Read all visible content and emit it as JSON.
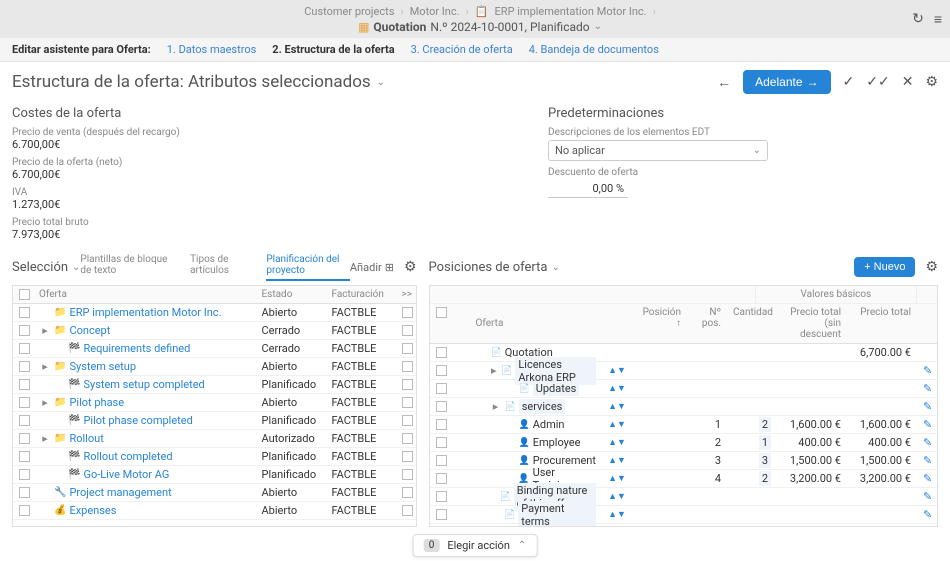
{
  "breadcrumb": {
    "items": [
      "Customer projects",
      "Motor Inc.",
      "ERP implementation Motor Inc."
    ],
    "doc_icon": "📄",
    "doc_title": "Quotation",
    "doc_number": "N.º 2024-10-0001, Planificado"
  },
  "wizard": {
    "label": "Editar asistente para Oferta:",
    "steps": [
      "1. Datos maestros",
      "2. Estructura de la oferta",
      "3. Creación de oferta",
      "4. Bandeja de documentos"
    ],
    "active_index": 1
  },
  "page": {
    "title": "Estructura de la oferta: Atributos seleccionados",
    "next_btn": "Adelante"
  },
  "costs": {
    "title": "Costes de la oferta",
    "items": [
      {
        "label": "Precio de venta (después del recargo)",
        "value": "6.700,00€"
      },
      {
        "label": "Precio de la oferta (neto)",
        "value": "6.700,00€"
      },
      {
        "label": "IVA",
        "value": "1.273,00€"
      },
      {
        "label": "Precio total bruto",
        "value": "7.973,00€"
      }
    ]
  },
  "defaults": {
    "title": "Predeterminaciones",
    "edt_label": "Descripciones de los elementos EDT",
    "edt_value": "No aplicar",
    "discount_label": "Descuento de oferta",
    "discount_value": "0,00 %"
  },
  "selection": {
    "title": "Selección",
    "tabs": [
      "Plantillas de bloque de texto",
      "Tipos de artículos",
      "Planificación del proyecto"
    ],
    "active_tab": 2,
    "add_label": "Añadir",
    "columns": {
      "name": "Oferta",
      "estado": "Estado",
      "fact": "Facturación",
      "star": ">>"
    },
    "rows": [
      {
        "indent": 0,
        "caret": "",
        "icon": "📁",
        "name": "ERP implementation Motor Inc.",
        "link": true,
        "estado": "Abierto",
        "fact": "FACTBLE"
      },
      {
        "indent": 0,
        "caret": "▸",
        "icon": "📁",
        "name": "Concept",
        "link": true,
        "estado": "Cerrado",
        "fact": "FACTBLE"
      },
      {
        "indent": 1,
        "caret": "",
        "icon": "🏁",
        "name": "Requirements defined",
        "link": true,
        "estado": "Cerrado",
        "fact": "FACTBLE"
      },
      {
        "indent": 0,
        "caret": "▸",
        "icon": "📁",
        "name": "System setup",
        "link": true,
        "estado": "Abierto",
        "fact": "FACTBLE"
      },
      {
        "indent": 1,
        "caret": "",
        "icon": "🏁",
        "name": "System setup completed",
        "link": true,
        "estado": "Planificado",
        "fact": "FACTBLE"
      },
      {
        "indent": 0,
        "caret": "▸",
        "icon": "📁",
        "name": "Pilot phase",
        "link": true,
        "estado": "Abierto",
        "fact": "FACTBLE"
      },
      {
        "indent": 1,
        "caret": "",
        "icon": "🏁",
        "name": "Pilot phase completed",
        "link": true,
        "estado": "Planificado",
        "fact": "FACTBLE"
      },
      {
        "indent": 0,
        "caret": "▸",
        "icon": "📁",
        "name": "Rollout",
        "link": true,
        "estado": "Autorizado",
        "fact": "FACTBLE"
      },
      {
        "indent": 1,
        "caret": "",
        "icon": "🏁",
        "name": "Rollout completed",
        "link": true,
        "estado": "Planificado",
        "fact": "FACTBLE"
      },
      {
        "indent": 1,
        "caret": "",
        "icon": "🏁",
        "name": "Go-Live Motor AG",
        "link": true,
        "estado": "Planificado",
        "fact": "FACTBLE"
      },
      {
        "indent": 0,
        "caret": "",
        "icon": "🔧",
        "name": "Project management",
        "link": true,
        "estado": "Abierto",
        "fact": "FACTBLE"
      },
      {
        "indent": 0,
        "caret": "",
        "icon": "💰",
        "name": "Expenses",
        "link": true,
        "estado": "Abierto",
        "fact": "FACTBLE"
      }
    ]
  },
  "positions": {
    "title": "Posiciones de oferta",
    "new_btn": "Nuevo",
    "group_header": "Valores básicos",
    "columns": {
      "offer": "Oferta",
      "pos": "Posición ↑",
      "npos": "Nº pos.",
      "qty": "Cantidad",
      "price": "Precio total (sin descuent",
      "total": "Precio total"
    },
    "rows": [
      {
        "indent": 0,
        "caret": "",
        "icon": "📄",
        "name": "Quotation",
        "pos": "",
        "npos": "",
        "qty": "",
        "price": "",
        "total": "6,700.00 €",
        "edit": false,
        "arrows": false
      },
      {
        "indent": 1,
        "caret": "▸",
        "icon": "📄",
        "name": "Licences Arkona ERP",
        "pos": "",
        "npos": "",
        "qty": "",
        "price": "",
        "total": "",
        "edit": true,
        "arrows": true,
        "editable": true
      },
      {
        "indent": 2,
        "caret": "",
        "icon": "📄",
        "name": "Updates",
        "pos": "",
        "npos": "",
        "qty": "",
        "price": "",
        "total": "",
        "edit": true,
        "arrows": true,
        "editable": true
      },
      {
        "indent": 1,
        "caret": "▸",
        "icon": "📄",
        "name": "services",
        "pos": "",
        "npos": "",
        "qty": "",
        "price": "",
        "total": "",
        "edit": true,
        "arrows": true,
        "editable": true
      },
      {
        "indent": 2,
        "caret": "",
        "icon": "👤",
        "name": "Admin",
        "pos": "",
        "npos": "1",
        "qty": "2",
        "price": "1,600.00 €",
        "total": "1,600.00 €",
        "edit": true,
        "arrows": true
      },
      {
        "indent": 2,
        "caret": "",
        "icon": "👤",
        "name": "Employee",
        "pos": "",
        "npos": "2",
        "qty": "1",
        "price": "400.00 €",
        "total": "400.00 €",
        "edit": true,
        "arrows": true
      },
      {
        "indent": 2,
        "caret": "",
        "icon": "👤",
        "name": "Procurement",
        "pos": "",
        "npos": "3",
        "qty": "3",
        "price": "1,500.00 €",
        "total": "1,500.00 €",
        "edit": true,
        "arrows": true
      },
      {
        "indent": 2,
        "caret": "",
        "icon": "👤",
        "name": "User Training",
        "pos": "",
        "npos": "4",
        "qty": "2",
        "price": "3,200.00 €",
        "total": "3,200.00 €",
        "edit": true,
        "arrows": true
      },
      {
        "indent": 1,
        "caret": "",
        "icon": "📄",
        "name": "Binding nature of this offer",
        "pos": "",
        "npos": "",
        "qty": "",
        "price": "",
        "total": "",
        "edit": true,
        "arrows": true,
        "editable": true
      },
      {
        "indent": 1,
        "caret": "",
        "icon": "📄",
        "name": "Payment terms",
        "pos": "",
        "npos": "",
        "qty": "",
        "price": "",
        "total": "",
        "edit": true,
        "arrows": true,
        "editable": true
      }
    ]
  },
  "footer": {
    "count": "0",
    "action": "Elegir acción"
  }
}
